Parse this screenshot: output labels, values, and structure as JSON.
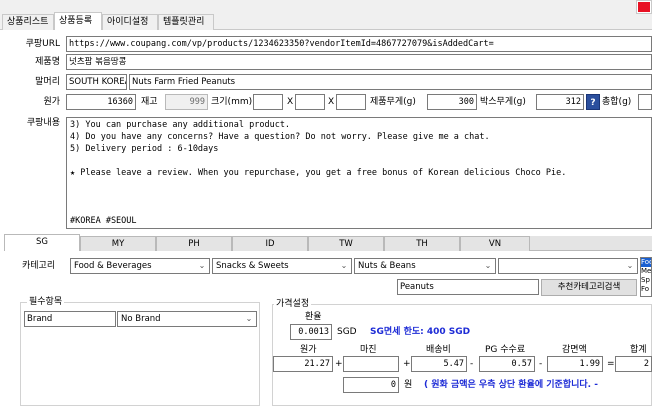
{
  "tabs": [
    "상품리스트",
    "상품등록",
    "아이디설정",
    "템플릿관리"
  ],
  "active_tab_index": 1,
  "form": {
    "url_label": "쿠팡URL",
    "url_value": "https://www.coupang.com/vp/products/1234623350?vendorItemId=4867727079&isAddedCart=",
    "product_name_label": "제품명",
    "product_name_value": "넛츠팜 볶음땅콩",
    "header_label": "말머리",
    "header_prefix": "SOUTH KOREA",
    "header_title": "Nuts Farm Fried Peanuts",
    "cost_label": "원가",
    "cost_value": "16360",
    "stock_label": "재고",
    "stock_value": "999",
    "size_label": "크기(mm)",
    "x1": "X",
    "x2": "X",
    "size_w": "",
    "size_h": "",
    "size_d": "",
    "product_weight_label": "제품무게(g)",
    "product_weight_value": "300",
    "box_weight_label": "박스무게(g)",
    "box_weight_value": "312",
    "help_label": "?",
    "total_label": "총합(g)",
    "total_value": "",
    "content_label": "쿠팡내용",
    "content_lines": [
      "3) You can purchase any additional product.",
      "4) Do you have any concerns? Have a question? Do not worry. Please give me a chat.",
      "5) Delivery period : 6-10days",
      "",
      "★ Please leave a review. When you repurchase, you get a free bonus of Korean delicious Choco Pie.",
      "",
      "",
      "",
      "#KOREA #SEOUL"
    ]
  },
  "country_tabs": [
    "SG",
    "MY",
    "PH",
    "ID",
    "TW",
    "TH",
    "VN"
  ],
  "active_country_index": 0,
  "category": {
    "label": "카테고리",
    "level1": "Food & Beverages",
    "level2": "Snacks & Sweets",
    "level3": "Nuts & Beans",
    "level4": "",
    "search_value": "Peanuts",
    "recommend_button": "추천카테고리검색",
    "list_items": [
      "Foo",
      "Me",
      "Sp",
      "Fo"
    ]
  },
  "required": {
    "title": "필수항목",
    "field_name": "Brand",
    "field_value": "No Brand"
  },
  "pricing": {
    "title": "가격설정",
    "exchange_label": "환율",
    "exchange_value": "0.0013",
    "currency": "SGD",
    "duty_free_text": "SG면세 한도: 400 SGD",
    "col_cost": "원가",
    "col_margin": "마진",
    "col_shipping": "배송비",
    "col_pg_fee": "PG 수수료",
    "col_discount": "감면액",
    "col_total": "합계",
    "val_cost": "21.27",
    "val_margin": "",
    "val_shipping": "5.47",
    "val_pg_fee": "0.57",
    "val_discount": "1.99",
    "val_total": "2",
    "op_plus1": "+",
    "op_plus2": "+",
    "op_minus1": "-",
    "op_minus2": "-",
    "op_eq": "=",
    "won_value": "0",
    "won_unit": "원",
    "won_note": "( 원화 금액은 우측 상단 환율에 기준합니다. -"
  }
}
